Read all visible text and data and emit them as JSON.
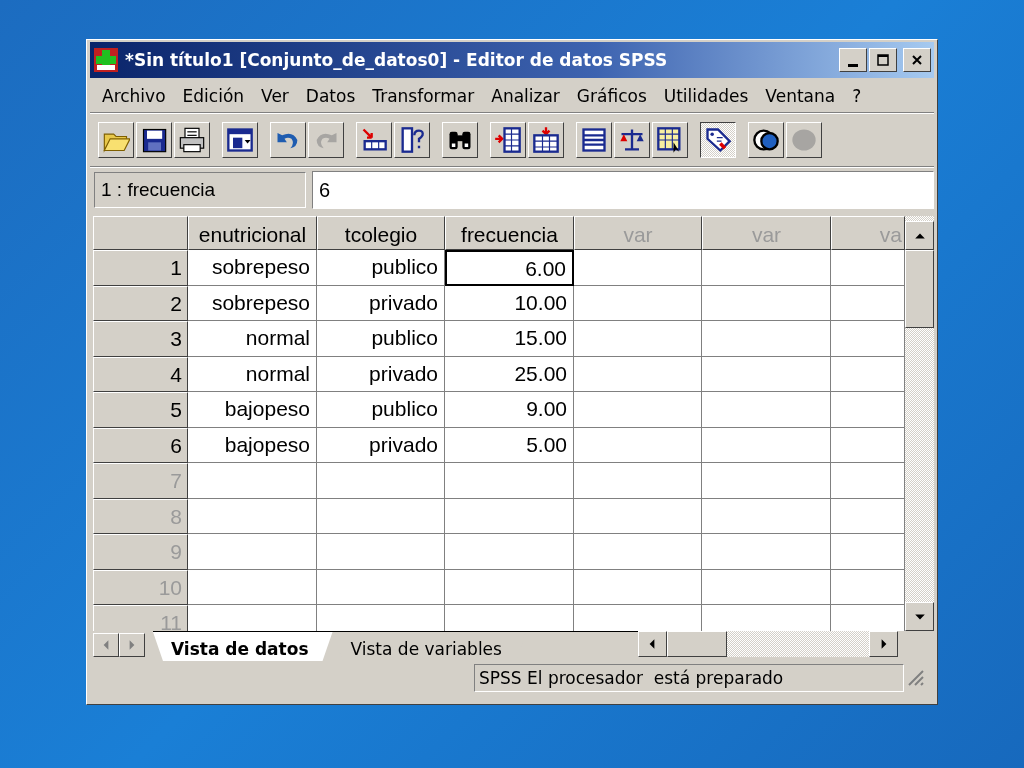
{
  "window": {
    "title": "*Sin título1 [Conjunto_de_datos0] - Editor de datos SPSS"
  },
  "menu": [
    "Archivo",
    "Edición",
    "Ver",
    "Datos",
    "Transformar",
    "Analizar",
    "Gráficos",
    "Utilidades",
    "Ventana",
    "?"
  ],
  "toolbar_groups": [
    {
      "buttons": [
        {
          "kind": "open",
          "disabled": false,
          "pressed": false
        },
        {
          "kind": "save",
          "disabled": false,
          "pressed": false
        },
        {
          "kind": "print",
          "disabled": false,
          "pressed": false
        }
      ]
    },
    {
      "buttons": [
        {
          "kind": "dialog",
          "disabled": false,
          "pressed": false
        }
      ]
    },
    {
      "buttons": [
        {
          "kind": "undo",
          "disabled": false,
          "pressed": false
        },
        {
          "kind": "redo",
          "disabled": true,
          "pressed": false
        }
      ]
    },
    {
      "buttons": [
        {
          "kind": "goto",
          "disabled": false,
          "pressed": false
        },
        {
          "kind": "variables",
          "disabled": false,
          "pressed": false
        }
      ]
    },
    {
      "buttons": [
        {
          "kind": "find",
          "disabled": false,
          "pressed": false
        }
      ]
    },
    {
      "buttons": [
        {
          "kind": "insert_case",
          "disabled": false,
          "pressed": false
        },
        {
          "kind": "insert_variable",
          "disabled": false,
          "pressed": false
        }
      ]
    },
    {
      "buttons": [
        {
          "kind": "split",
          "disabled": false,
          "pressed": false
        },
        {
          "kind": "weight",
          "disabled": false,
          "pressed": false
        },
        {
          "kind": "select",
          "disabled": false,
          "pressed": false
        }
      ]
    },
    {
      "buttons": [
        {
          "kind": "labels",
          "disabled": false,
          "pressed": true
        }
      ]
    },
    {
      "buttons": [
        {
          "kind": "sets",
          "disabled": false,
          "pressed": false
        },
        {
          "kind": "show_all",
          "disabled": true,
          "pressed": false
        }
      ]
    }
  ],
  "cell_editor": {
    "label": "1 : frecuencia",
    "value": "6"
  },
  "table": {
    "columns": [
      {
        "label": "enutricional",
        "defined": true
      },
      {
        "label": "tcolegio",
        "defined": true
      },
      {
        "label": "frecuencia",
        "defined": true
      },
      {
        "label": "var",
        "defined": false
      },
      {
        "label": "var",
        "defined": false
      },
      {
        "label": "va",
        "defined": false
      }
    ],
    "rows": [
      {
        "number": "1",
        "cells": [
          {
            "text": "sobrepeso",
            "selected": false
          },
          {
            "text": "publico",
            "selected": false
          },
          {
            "text": "6.00",
            "selected": true
          }
        ]
      },
      {
        "number": "2",
        "cells": [
          {
            "text": "sobrepeso",
            "selected": false
          },
          {
            "text": "privado",
            "selected": false
          },
          {
            "text": "10.00",
            "selected": false
          }
        ]
      },
      {
        "number": "3",
        "cells": [
          {
            "text": "normal",
            "selected": false
          },
          {
            "text": "publico",
            "selected": false
          },
          {
            "text": "15.00",
            "selected": false
          }
        ]
      },
      {
        "number": "4",
        "cells": [
          {
            "text": "normal",
            "selected": false
          },
          {
            "text": "privado",
            "selected": false
          },
          {
            "text": "25.00",
            "selected": false
          }
        ]
      },
      {
        "number": "5",
        "cells": [
          {
            "text": "bajopeso",
            "selected": false
          },
          {
            "text": "publico",
            "selected": false
          },
          {
            "text": "9.00",
            "selected": false
          }
        ]
      },
      {
        "number": "6",
        "cells": [
          {
            "text": "bajopeso",
            "selected": false
          },
          {
            "text": "privado",
            "selected": false
          },
          {
            "text": "5.00",
            "selected": false
          }
        ]
      },
      {
        "number": "7"
      },
      {
        "number": "8"
      },
      {
        "number": "9"
      },
      {
        "number": "10"
      },
      {
        "number": "11"
      }
    ]
  },
  "tabs": [
    {
      "label": "Vista de datos",
      "selected": true
    },
    {
      "label": "Vista de variables",
      "selected": false
    }
  ],
  "status_bar": {
    "text": "SPSS El procesador  está preparado"
  }
}
